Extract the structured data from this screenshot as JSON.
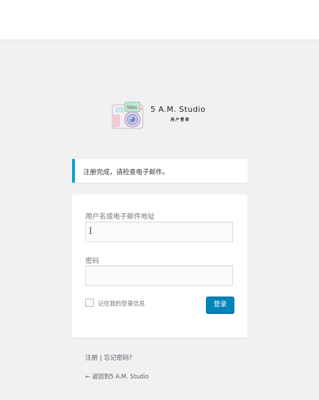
{
  "site": {
    "title": "5 A.M. Studio",
    "subtitle": "用户登录"
  },
  "notice": {
    "message": "注册完成，请检查电子邮件。",
    "accent_color": "#00a0d2"
  },
  "form": {
    "username_label": "用户名或电子邮件地址",
    "username_value": "",
    "password_label": "密码",
    "password_value": "",
    "remember_label": "记住我的登录信息",
    "remember_checked": false,
    "submit_label": "登录",
    "button_color": "#0085ba"
  },
  "links": {
    "register": "注册",
    "separator": "|",
    "lost_password": "忘记密码？",
    "back_arrow": "←",
    "back_to_site": "返回到5 A.M. Studio"
  },
  "icons": {
    "logo": "camera-logo-icon",
    "text_cursor": "text-cursor-icon"
  }
}
